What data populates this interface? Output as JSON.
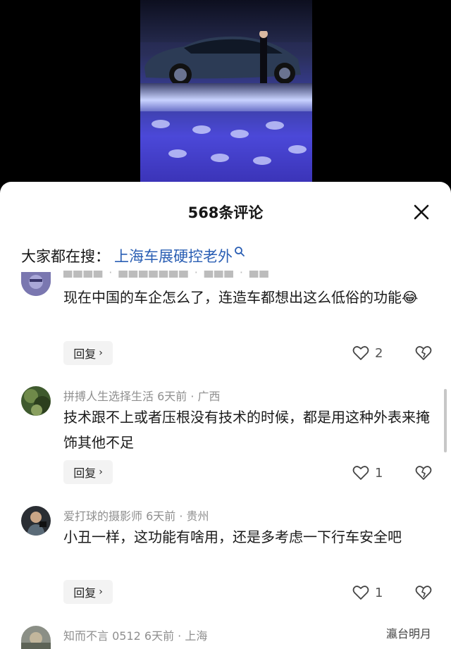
{
  "sheet": {
    "title": "568条评论",
    "close_icon": "close-icon"
  },
  "search": {
    "prefix": "大家都在搜：",
    "query": "上海车展硬控老外",
    "icon": "search-icon"
  },
  "comments": [
    {
      "meta": "",
      "text": "现在中国的车企怎么了，连造车都想出这么低俗的功能",
      "emoji": "😂",
      "reply_label": "回复",
      "likes": "2"
    },
    {
      "meta": "拼搏人生选择生活   6天前 · 广西",
      "text": "技术跟不上或者压根没有技术的时候，都是用这种外表来掩饰其他不足",
      "reply_label": "回复",
      "likes": "1"
    },
    {
      "meta": "爱打球的摄影师   6天前 · 贵州",
      "text": "小丑一样，这功能有啥用，还是多考虑一下行车安全吧",
      "reply_label": "回复",
      "likes": "1"
    },
    {
      "meta": "知而不言 0512   6天前 · 上海"
    }
  ],
  "watermark": "瀛台明月"
}
